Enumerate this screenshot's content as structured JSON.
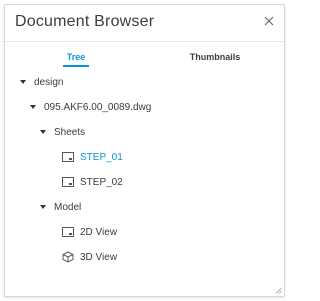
{
  "panel": {
    "title": "Document Browser",
    "close_icon": "close-icon"
  },
  "tabs": [
    {
      "label": "Tree",
      "active": true
    },
    {
      "label": "Thumbnails",
      "active": false
    }
  ],
  "tree": {
    "root": {
      "label": "design",
      "expanded": true
    },
    "file": {
      "label": "095.AKF6.00_0089.dwg",
      "expanded": true
    },
    "sheets": {
      "label": "Sheets",
      "expanded": true
    },
    "sheet_items": [
      {
        "label": "STEP_01",
        "selected": true,
        "icon": "sheet-icon"
      },
      {
        "label": "STEP_02",
        "selected": false,
        "icon": "sheet-icon"
      }
    ],
    "model": {
      "label": "Model",
      "expanded": true
    },
    "model_items": [
      {
        "label": "2D View",
        "icon": "sheet-icon"
      },
      {
        "label": "3D View",
        "icon": "cube-icon"
      }
    ]
  },
  "colors": {
    "accent": "#0696d7",
    "text": "#3c3c3c",
    "border": "#d6d6d6"
  }
}
